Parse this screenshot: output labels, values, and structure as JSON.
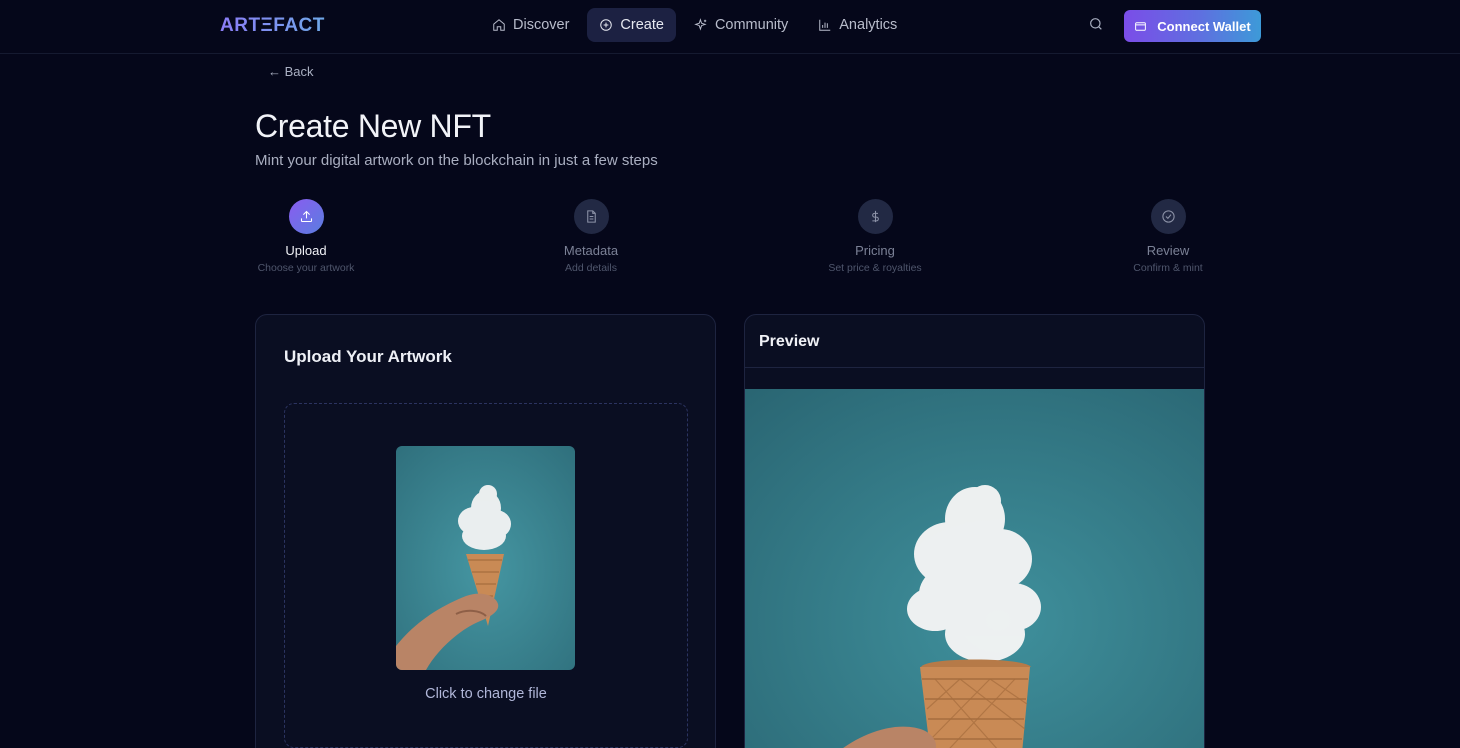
{
  "app": {
    "logo": "ARTΞFACT"
  },
  "nav": {
    "items": [
      {
        "label": "Discover",
        "icon": "home-icon",
        "active": false
      },
      {
        "label": "Create",
        "icon": "plus-circle-icon",
        "active": true
      },
      {
        "label": "Community",
        "icon": "sparkle-icon",
        "active": false
      },
      {
        "label": "Analytics",
        "icon": "bar-chart-icon",
        "active": false
      }
    ],
    "wallet_label": "Connect Wallet"
  },
  "page": {
    "back_label": "← Back",
    "title": "Create New NFT",
    "subtitle": "Mint your digital artwork on the blockchain in just a few steps"
  },
  "steps": [
    {
      "label": "Upload",
      "sub": "Choose your artwork",
      "icon": "upload-icon",
      "active": true
    },
    {
      "label": "Metadata",
      "sub": "Add details",
      "icon": "document-icon",
      "active": false
    },
    {
      "label": "Pricing",
      "sub": "Set price & royalties",
      "icon": "dollar-icon",
      "active": false
    },
    {
      "label": "Review",
      "sub": "Confirm & mint",
      "icon": "check-circle-icon",
      "active": false
    }
  ],
  "upload": {
    "title": "Upload Your Artwork",
    "change_text": "Click to change file"
  },
  "preview": {
    "title": "Preview"
  },
  "colors": {
    "background": "#05071a",
    "accent_start": "#7b4de8",
    "accent_end": "#3d9ad8",
    "artwork_bg": "#3d8b98"
  }
}
